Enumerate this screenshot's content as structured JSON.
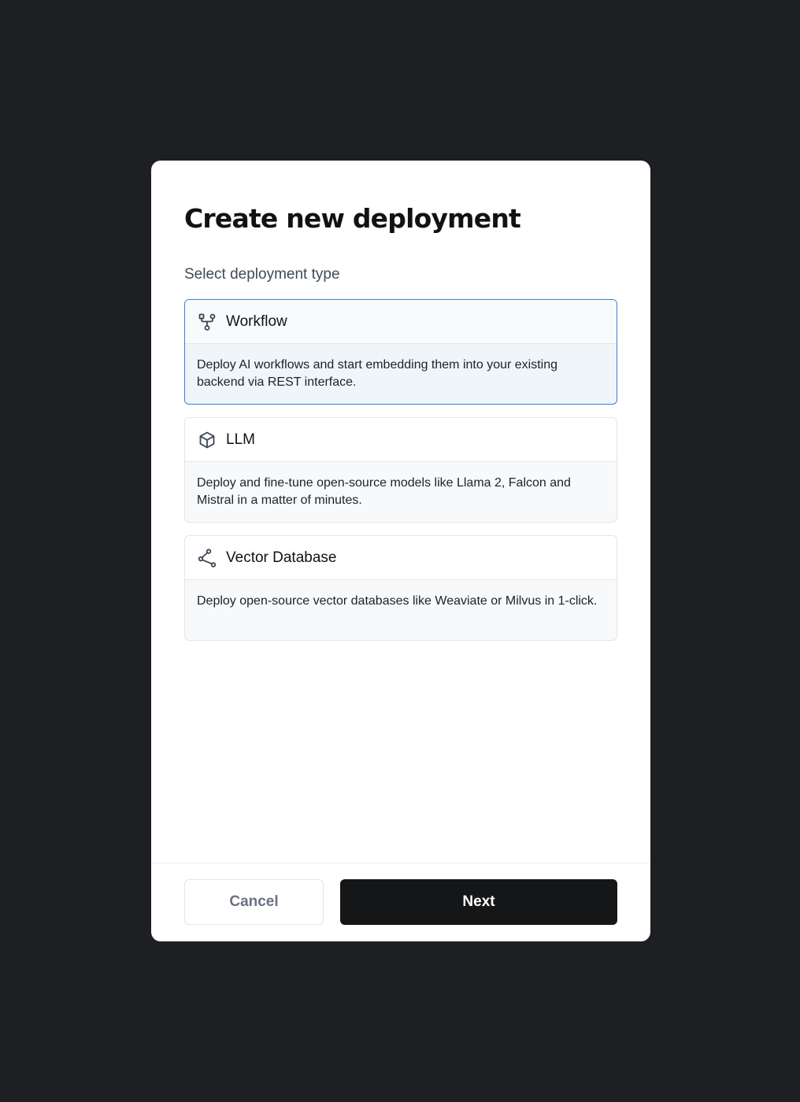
{
  "dialog": {
    "title": "Create new deployment",
    "section_label": "Select deployment type"
  },
  "options": [
    {
      "title": "Workflow",
      "description": "Deploy AI workflows and start embedding them into your existing backend via REST interface.",
      "icon": "workflow-icon",
      "selected": true
    },
    {
      "title": "LLM",
      "description": "Deploy and fine-tune open-source models like Llama 2, Falcon and Mistral in a matter of minutes.",
      "icon": "cube-icon",
      "selected": false
    },
    {
      "title": "Vector Database",
      "description": "Deploy open-source vector databases like Weaviate or Milvus in 1-click.",
      "icon": "share-nodes-icon",
      "selected": false
    }
  ],
  "footer": {
    "cancel_label": "Cancel",
    "next_label": "Next"
  },
  "colors": {
    "backdrop": "#1e1f22",
    "selected_border": "#3b7de0",
    "primary_button": "#151618"
  }
}
